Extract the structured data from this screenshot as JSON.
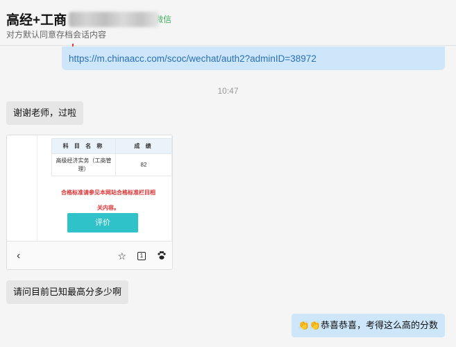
{
  "header": {
    "title": "高经+工商",
    "wechat_tag": "微信",
    "subtitle": "对方默认同意存档会话内容"
  },
  "messages": {
    "link": "https://m.chinaacc.com/scoc/wechat/auth2?adminID=38972",
    "timestamp": "10:47",
    "msg1": "谢谢老师，过啦",
    "image": {
      "table_header_subject": "科 目 名 称",
      "table_header_score": "成 绩",
      "row_subject": "高级经济实务（工商管理）",
      "row_score": "82",
      "note_line1": "合格标准请参见本网站合格标准栏目相",
      "note_line2": "关内容。",
      "eval_button": "评价",
      "tab_count": "1"
    },
    "msg2": "请问目前已知最高分多少啊",
    "msg3_emoji": "👏👏",
    "msg3_text": "恭喜恭喜，考得这么高的分数"
  },
  "icons": {
    "back": "back-icon",
    "star": "star-icon",
    "tabs": "tabs-icon",
    "paw": "paw-icon"
  }
}
